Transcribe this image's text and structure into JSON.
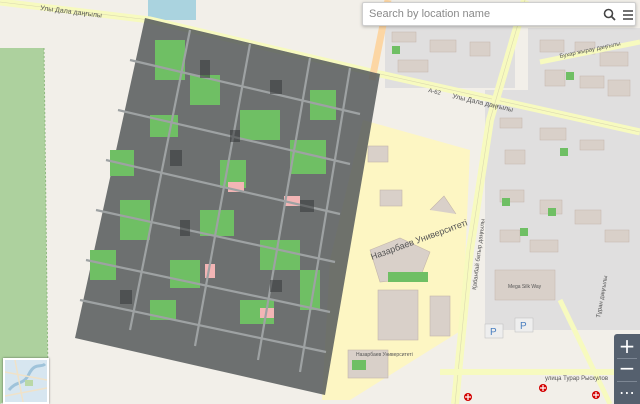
{
  "search": {
    "placeholder": "Search by location name"
  },
  "icons": {
    "search": "search-icon",
    "menu": "menu-icon",
    "zoom_in": "plus-icon",
    "zoom_out": "minus-icon",
    "more": "more-icon"
  },
  "zoom_controls": {
    "in_label": "+",
    "out_label": "−",
    "more_label": "⋯"
  },
  "map_labels": {
    "street_north": "Улы Дала даңғылы",
    "street_north_2": "Улы Дала даңғылы",
    "road_ref": "A-62",
    "street_east_top": "Бухар жырау даңғылы",
    "street_kabanbay": "Қабанбай батыр даңғылы",
    "street_turan": "Тұран даңғылы",
    "university": "Назарбаев Университеті",
    "mall": "Mega Silk Way",
    "street_south": "улица Турар Рыскулов",
    "campus_name": "Назарбаев Университеті"
  },
  "colors": {
    "background": "#f2efe9",
    "grass": "#6fbf64",
    "overlay": "#5a5e5f",
    "campus": "#fdf6c3",
    "road_major": "#f7fabf",
    "road_primary": "#fcd6a4",
    "building": "#d9d0c9",
    "hospital": "#d20000"
  }
}
